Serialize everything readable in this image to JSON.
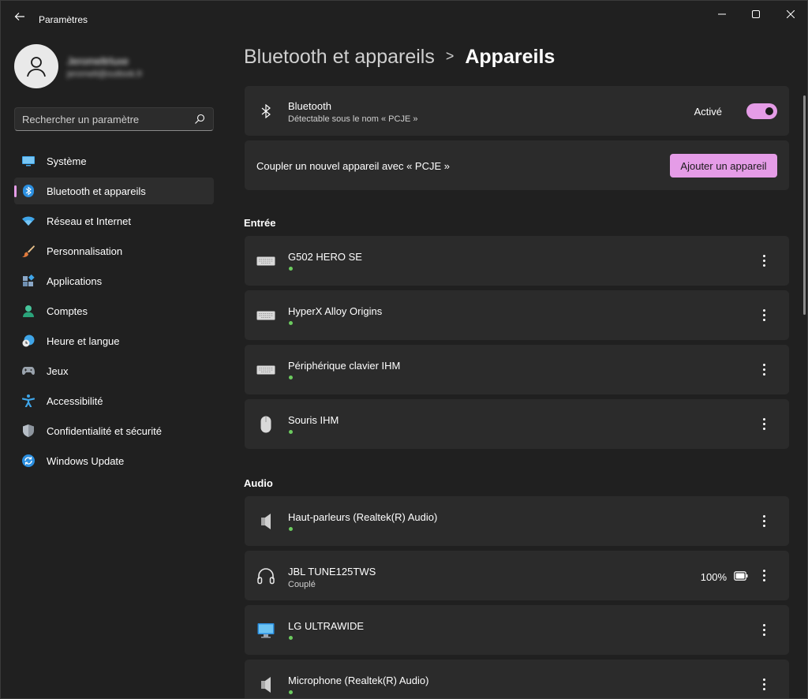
{
  "window": {
    "title": "Paramètres",
    "controls": {
      "minimize": "minimize-icon",
      "maximize": "maximize-icon",
      "close": "close-icon"
    }
  },
  "profile": {
    "name": "Jeromeltrluxe",
    "email": "jeromelt@outlook.fr"
  },
  "search": {
    "placeholder": "Rechercher un paramètre"
  },
  "sidebar": {
    "active_accent": "#e59ce7",
    "items": [
      {
        "label": "Système",
        "icon": "system-icon"
      },
      {
        "label": "Bluetooth et appareils",
        "icon": "bluetooth-icon",
        "active": true
      },
      {
        "label": "Réseau et Internet",
        "icon": "wifi-icon"
      },
      {
        "label": "Personnalisation",
        "icon": "brush-icon"
      },
      {
        "label": "Applications",
        "icon": "apps-icon"
      },
      {
        "label": "Comptes",
        "icon": "account-icon"
      },
      {
        "label": "Heure et langue",
        "icon": "clock-globe-icon"
      },
      {
        "label": "Jeux",
        "icon": "gamepad-icon"
      },
      {
        "label": "Accessibilité",
        "icon": "accessibility-icon"
      },
      {
        "label": "Confidentialité et sécurité",
        "icon": "shield-icon"
      },
      {
        "label": "Windows Update",
        "icon": "update-icon"
      }
    ]
  },
  "breadcrumb": {
    "parent": "Bluetooth et appareils",
    "separator": ">",
    "current": "Appareils"
  },
  "bluetooth": {
    "title": "Bluetooth",
    "subtitle": "Détectable sous le nom « PCJE »",
    "toggle_label": "Activé",
    "enabled": true
  },
  "pair": {
    "text": "Coupler un nouvel appareil avec « PCJE »",
    "button_label": "Ajouter un appareil"
  },
  "sections": {
    "input": {
      "title": "Entrée",
      "devices": [
        {
          "name": "G502 HERO SE",
          "icon": "keyboard-icon",
          "connected": true
        },
        {
          "name": "HyperX Alloy Origins",
          "icon": "keyboard-icon",
          "connected": true
        },
        {
          "name": "Périphérique clavier IHM",
          "icon": "keyboard-icon",
          "connected": true
        },
        {
          "name": "Souris IHM",
          "icon": "mouse-icon",
          "connected": true
        }
      ]
    },
    "audio": {
      "title": "Audio",
      "devices": [
        {
          "name": "Haut-parleurs (Realtek(R) Audio)",
          "icon": "speaker-icon",
          "connected": true
        },
        {
          "name": "JBL TUNE125TWS",
          "icon": "headphones-icon",
          "status": "Couplé",
          "battery": "100%",
          "battery_icon": "battery-icon"
        },
        {
          "name": "LG ULTRAWIDE",
          "icon": "monitor-icon",
          "connected": true
        },
        {
          "name": "Microphone (Realtek(R) Audio)",
          "icon": "speaker-icon",
          "connected": true
        }
      ]
    }
  },
  "colors": {
    "background": "#202020",
    "card": "#2b2b2b",
    "accent": "#e59ce7",
    "connected_dot": "#6ccb5f"
  }
}
